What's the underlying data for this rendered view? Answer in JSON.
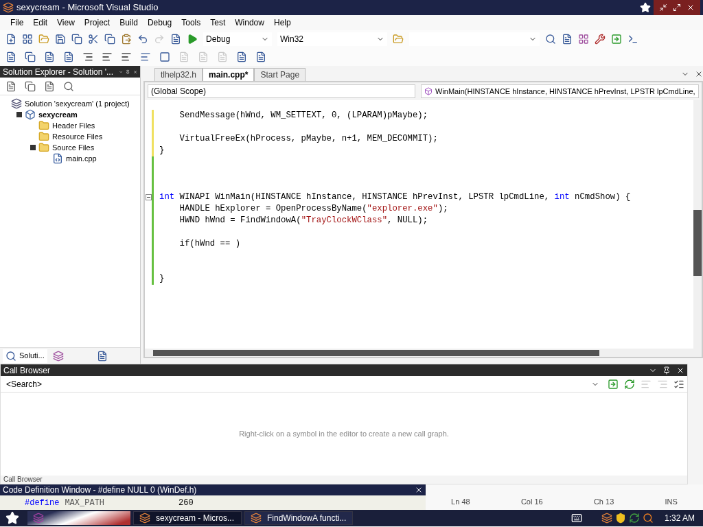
{
  "window": {
    "title": "sexycream - Microsoft Visual Studio"
  },
  "menu": [
    "File",
    "Edit",
    "View",
    "Project",
    "Build",
    "Debug",
    "Tools",
    "Test",
    "Window",
    "Help"
  ],
  "toolbar": {
    "configuration": "Debug",
    "platform": "Win32"
  },
  "solution_explorer": {
    "title": "Solution Explorer - Solution '...",
    "tree": [
      {
        "label": "Solution 'sexycream' (1 project)",
        "kind": "solution",
        "bold": false,
        "children": [
          {
            "label": "sexycream",
            "kind": "project",
            "bold": true,
            "expanded": true,
            "children": [
              {
                "label": "Header Files",
                "kind": "folder",
                "bold": false
              },
              {
                "label": "Resource Files",
                "kind": "folder",
                "bold": false
              },
              {
                "label": "Source Files",
                "kind": "folder",
                "bold": false,
                "expanded": true,
                "children": [
                  {
                    "label": "main.cpp",
                    "kind": "cpp",
                    "bold": false
                  }
                ]
              }
            ]
          }
        ]
      }
    ],
    "bottom_tab": "Soluti..."
  },
  "editor": {
    "tabs": [
      {
        "label": "tlhelp32.h",
        "selected": false
      },
      {
        "label": "main.cpp*",
        "selected": true
      },
      {
        "label": "Start Page",
        "selected": false
      }
    ],
    "scope": "(Global Scope)",
    "member": "WinMain(HINSTANCE hInstance, HINSTANCE hPrevInst, LPSTR lpCmdLine,",
    "lines": [
      {
        "saved": false,
        "tokens": [
          {
            "kind": "text",
            "text": "    SendMessage(hWnd, WM_SETTEXT, 0, (LPARAM)pMaybe);"
          }
        ]
      },
      {
        "saved": false
      },
      {
        "saved": false,
        "tokens": [
          {
            "kind": "text",
            "text": "    VirtualFreeEx(hProcess, pMaybe, n+1, MEM_DECOMMIT);"
          }
        ]
      },
      {
        "saved": false,
        "tokens": [
          {
            "kind": "text",
            "text": "}"
          }
        ]
      },
      {
        "saved": true
      },
      {
        "saved": true
      },
      {
        "saved": true
      },
      {
        "saved": true,
        "fold": true,
        "tokens": [
          {
            "kind": "keyword",
            "text": "int"
          },
          {
            "kind": "text",
            "text": " WINAPI WinMain(HINSTANCE hInstance, HINSTANCE hPrevInst, LPSTR lpCmdLine, "
          },
          {
            "kind": "keyword",
            "text": "int"
          },
          {
            "kind": "text",
            "text": " nCmdShow) {"
          }
        ]
      },
      {
        "saved": true,
        "tokens": [
          {
            "kind": "text",
            "text": "    HANDLE hExplorer = OpenProcessByName("
          },
          {
            "kind": "string",
            "text": "\"explorer.exe\""
          },
          {
            "kind": "text",
            "text": ");"
          }
        ]
      },
      {
        "saved": true,
        "tokens": [
          {
            "kind": "text",
            "text": "    HWND hWnd = FindWindowA("
          },
          {
            "kind": "string",
            "text": "\"TrayClockWClass\""
          },
          {
            "kind": "text",
            "text": ", NULL);"
          }
        ]
      },
      {
        "saved": true
      },
      {
        "saved": true,
        "tokens": [
          {
            "kind": "text",
            "text": "    if(hWnd == )"
          }
        ]
      },
      {
        "saved": true
      },
      {
        "saved": true
      },
      {
        "saved": true,
        "tokens": [
          {
            "kind": "text",
            "text": "}"
          }
        ]
      }
    ]
  },
  "call_browser": {
    "title": "Call Browser",
    "search": "<Search>",
    "message": "Right-click on a symbol in the editor to create a new call graph.",
    "bottom_tab": "Call Browser"
  },
  "code_definition": {
    "title": "Code Definition Window - #define NULL 0 (WinDef.h)",
    "tokens": [
      {
        "kind": "keyword",
        "text": "#define"
      },
      {
        "kind": "name",
        "text": "MAX_PATH"
      },
      {
        "kind": "text",
        "text": "260"
      }
    ]
  },
  "status_bar": [
    "Ln 48",
    "Col 16",
    "Ch 13",
    "INS"
  ],
  "taskbar": {
    "buttons": [
      {
        "label": "sexycream - Micros...",
        "selected": true
      },
      {
        "label": "FindWindowA functi...",
        "selected": false
      }
    ],
    "clock": "1:32 AM"
  }
}
